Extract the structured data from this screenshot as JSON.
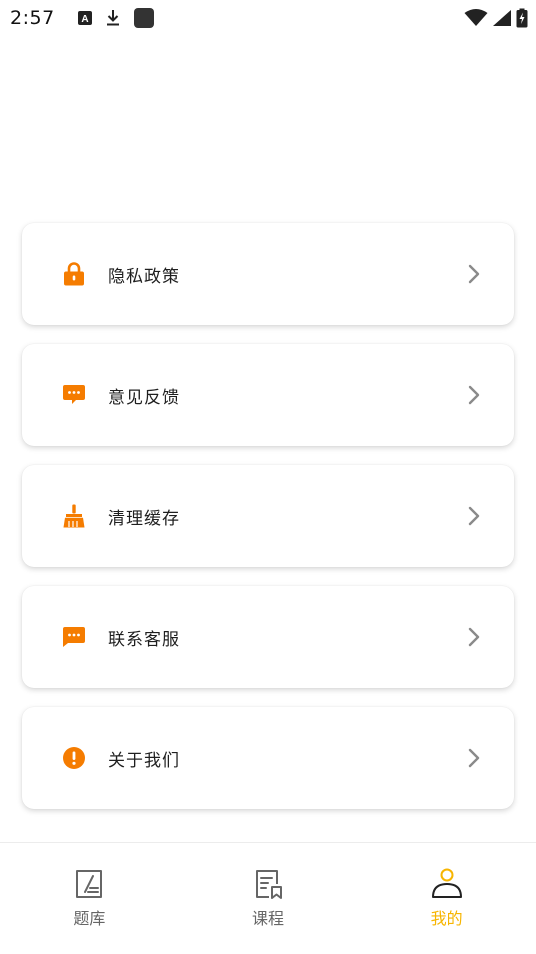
{
  "status_bar": {
    "time": "2:57",
    "icons": [
      "app-a-icon",
      "download-icon",
      "square-app-icon",
      "wifi-icon",
      "cell-signal-icon",
      "battery-charging-icon"
    ]
  },
  "menu": {
    "items": [
      {
        "label": "隐私政策",
        "icon": "lock-icon"
      },
      {
        "label": "意见反馈",
        "icon": "chat-bubble-icon"
      },
      {
        "label": "清理缓存",
        "icon": "broom-icon"
      },
      {
        "label": "联系客服",
        "icon": "message-icon"
      },
      {
        "label": "关于我们",
        "icon": "info-icon"
      }
    ],
    "accent_color": "#f57c00"
  },
  "bottom_nav": {
    "items": [
      {
        "label": "题库",
        "icon": "question-bank-icon",
        "active": false
      },
      {
        "label": "课程",
        "icon": "course-icon",
        "active": false
      },
      {
        "label": "我的",
        "icon": "profile-icon",
        "active": true
      }
    ],
    "active_color": "#f7b500",
    "inactive_color": "#666666"
  }
}
